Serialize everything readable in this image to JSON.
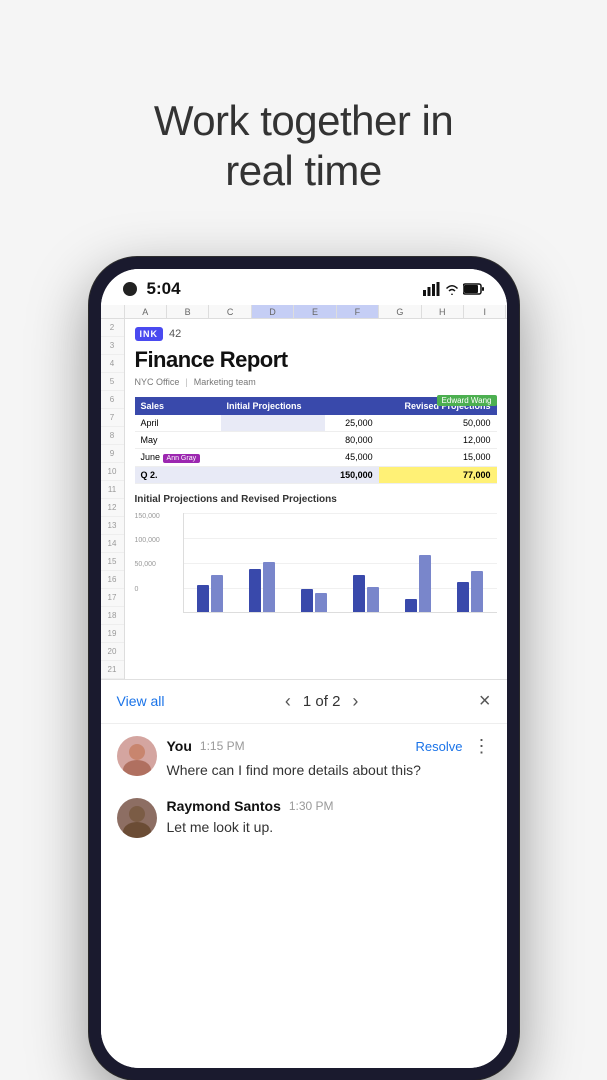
{
  "headline": {
    "line1": "Work together in",
    "line2": "real time"
  },
  "status_bar": {
    "time": "5:04"
  },
  "spreadsheet": {
    "columns": [
      "A",
      "B",
      "C",
      "D",
      "E",
      "F",
      "G",
      "H",
      "I"
    ],
    "logo_badge": "INK",
    "logo_number": "42",
    "report_title": "Finance Report",
    "subtitle_office": "NYC Office",
    "subtitle_team": "Marketing team",
    "edward_wang_tag": "Edward Wang",
    "table_headers": [
      "Sales",
      "Initial Projections",
      "",
      "Revised Projections"
    ],
    "table_rows": [
      {
        "label": "April",
        "initial": "25,000",
        "revised": "50,000",
        "highlighted": false
      },
      {
        "label": "May",
        "initial": "80,000",
        "revised": "12,000",
        "highlighted": false
      },
      {
        "label": "June",
        "initial": "45,000",
        "revised": "15,000",
        "highlighted": true,
        "tag": "Ann Gray"
      },
      {
        "label": "Q 2.",
        "initial": "150,000",
        "revised": "77,000",
        "total": true
      }
    ],
    "chart_title": "Initial Projections and Revised Projections",
    "chart_y_labels": [
      "150,000",
      "100,000",
      "50,000",
      "0"
    ],
    "chart_bar_groups": [
      {
        "dark": 40,
        "light": 55
      },
      {
        "dark": 65,
        "light": 75
      },
      {
        "dark": 35,
        "light": 28
      },
      {
        "dark": 55,
        "light": 38
      },
      {
        "dark": 20,
        "light": 85
      },
      {
        "dark": 45,
        "light": 62
      }
    ]
  },
  "chat_nav": {
    "view_all_label": "View all",
    "count_label": "1 of 2",
    "prev_arrow": "‹",
    "next_arrow": "›",
    "close": "×"
  },
  "messages": [
    {
      "author": "You",
      "time": "1:15 PM",
      "text": "Where can I find more details about this?",
      "resolve_label": "Resolve",
      "more": "⋮"
    },
    {
      "author": "Raymond Santos",
      "time": "1:30 PM",
      "text": "Let me look it up."
    }
  ]
}
